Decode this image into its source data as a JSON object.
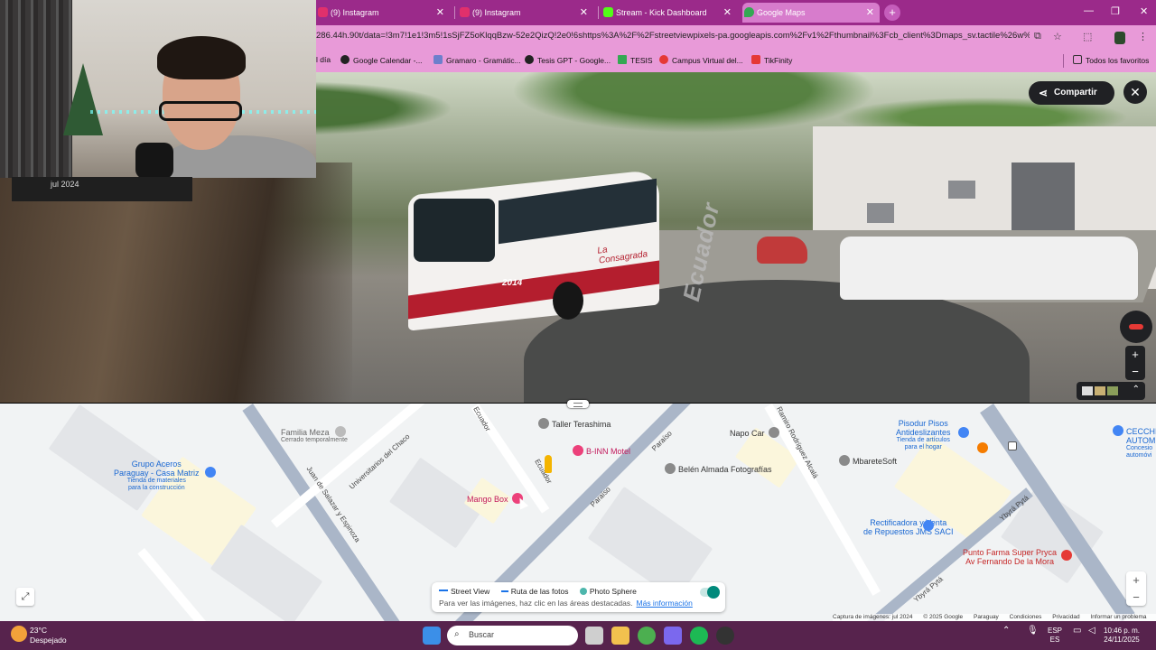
{
  "webcam": {
    "date_label": "jul 2024"
  },
  "tabs": [
    {
      "title": "(9) Instagram",
      "color": "#e1306c"
    },
    {
      "title": "(9) Instagram",
      "color": "#e1306c"
    },
    {
      "title": "Stream - Kick Dashboard",
      "color": "#53fc18"
    },
    {
      "title": "Google Maps",
      "color": "#34a853",
      "active": true
    }
  ],
  "browser": {
    "url": "286.44h.90t/data=!3m7!1e1!3m5!1sSjFZ5oKlqqBzw-52e2QizQ!2e0!6shttps%3A%2F%2Fstreetviewpixels-pa.googleapis.com%2Fv1%2Fthumbnail%3Fcb_client%3Dmaps_sv.tactile%26w%3D900%2..."
  },
  "bookmarks": {
    "partial": "l día",
    "items": [
      "Google Calendar -...",
      "Gramaro - Gramátic...",
      "Tesis GPT - Google...",
      "TESIS",
      "Campus Virtual del...",
      "TikFinity"
    ],
    "favorites": "Todos los favoritos"
  },
  "streetview": {
    "share_label": "Compartir",
    "street_label": "Ecuador",
    "bus_name": "La Consagrada",
    "bus_number": "2014"
  },
  "map": {
    "streets": [
      "Ecuador",
      "Universitarios del Chaco",
      "Juan de Salazar y Espinoza",
      "Paraíso",
      "Ramiro Rodríguez Alcalá",
      "Ybyrá Pytá"
    ],
    "pois": {
      "familia_meza": {
        "name": "Familia Meza",
        "sub": "Cerrado temporalmente"
      },
      "grupo_aceros": {
        "name": "Grupo Aceros Paraguay - Casa Matriz",
        "name1": "Grupo Aceros",
        "name2": "Paraguay - Casa Matriz",
        "sub1": "Tienda de materiales",
        "sub2": "para la construcción"
      },
      "taller": {
        "name": "Taller Terashima"
      },
      "binn": {
        "name": "B-INN Motel"
      },
      "mango": {
        "name": "Mango Box"
      },
      "napo": {
        "name": "Napo Car"
      },
      "belen": {
        "name": "Belén Almada Fotografías"
      },
      "mbarete": {
        "name": "MbareteSoft"
      },
      "pisodur": {
        "name1": "Pisodur Pisos",
        "name2": "Antideslizantes",
        "sub1": "Tienda de artículos",
        "sub2": "para el hogar"
      },
      "rectificadora": {
        "name1": "Rectificadora y Venta",
        "name2": "de Repuestos JMS SACI"
      },
      "punto_farma": {
        "name1": "Punto Farma Super Pryca",
        "name2": "Av Fernando De la Mora"
      },
      "cecchi": {
        "name1": "CECCHI",
        "name2": "AUTOM",
        "sub1": "Concesio",
        "sub2": "automóvi"
      }
    },
    "legend": {
      "street_view": "Street View",
      "photo_route": "Ruta de las fotos",
      "photo_sphere": "Photo Sphere",
      "hint": "Para ver las imágenes, haz clic en las áreas destacadas.",
      "more_info": "Más información"
    },
    "attribution": [
      "Captura de imágenes: jul 2024",
      "© 2025 Google",
      "Paraguay",
      "Condiciones",
      "Privacidad",
      "Informar un problema"
    ]
  },
  "taskbar": {
    "temp": "23°C",
    "weather": "Despejado",
    "search_placeholder": "Buscar",
    "lang1": "ESP",
    "lang2": "ES",
    "time": "10:46 p. m.",
    "date": "24/11/2025"
  }
}
